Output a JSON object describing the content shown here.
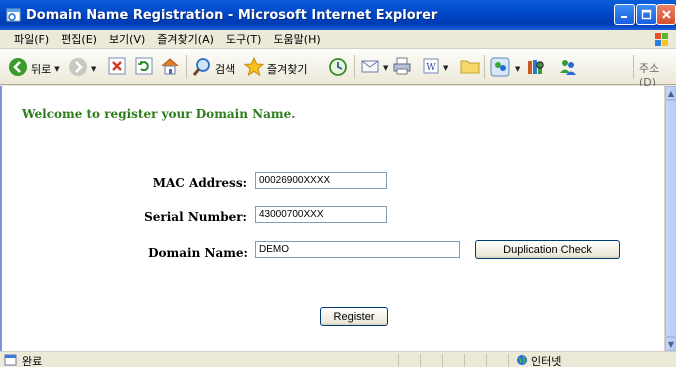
{
  "window": {
    "title": "Domain Name Registration - Microsoft Internet Explorer"
  },
  "menu": {
    "items": [
      "파일(F)",
      "편집(E)",
      "보기(V)",
      "즐겨찾기(A)",
      "도구(T)",
      "도움말(H)"
    ]
  },
  "toolbar": {
    "back_label": "뒤로",
    "search_label": "검색",
    "favorites_label": "즐겨찾기",
    "address_label": "주소(D)"
  },
  "page": {
    "welcome": "Welcome to register your Domain Name.",
    "mac_label": "MAC Address:",
    "mac_value": "00026900XXXX",
    "serial_label": "Serial Number:",
    "serial_value": "43000700XXX",
    "domain_label": "Domain Name:",
    "domain_value": "DEMO",
    "dup_check_label": "Duplication Check",
    "register_label": "Register"
  },
  "status": {
    "text": "완료",
    "zone": "인터넷"
  },
  "colors": {
    "welcome_text": "#2e7d1c",
    "titlebar": "#0046c8"
  }
}
